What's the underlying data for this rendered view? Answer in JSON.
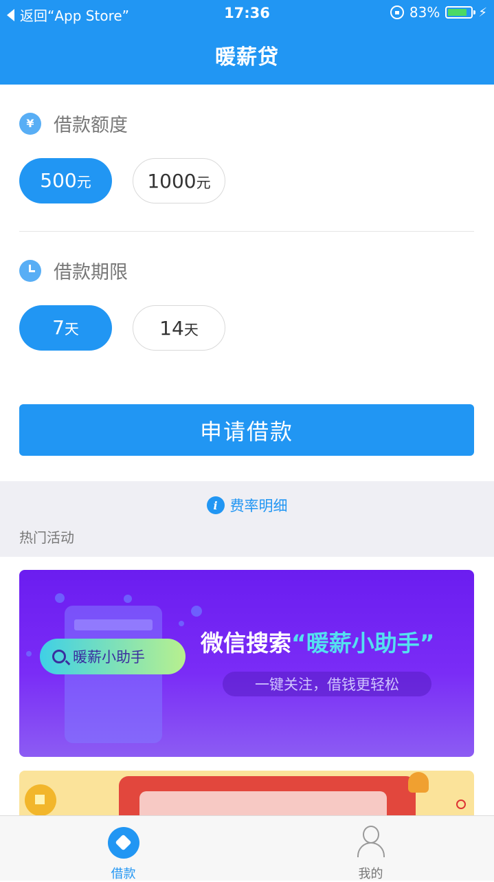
{
  "status_bar": {
    "back_label": "返回“App Store”",
    "time": "17:36",
    "battery": "83%",
    "battery_level": 0.83
  },
  "header": {
    "title": "暖薪贷"
  },
  "amount_section": {
    "label": "借款额度",
    "icon_glyph": "¥",
    "options": [
      {
        "value": "500",
        "unit": "元",
        "selected": true
      },
      {
        "value": "1000",
        "unit": "元",
        "selected": false
      }
    ]
  },
  "term_section": {
    "label": "借款期限",
    "options": [
      {
        "value": "7",
        "unit": "天",
        "selected": true
      },
      {
        "value": "14",
        "unit": "天",
        "selected": false
      }
    ]
  },
  "apply_button": "申请借款",
  "rate_link": {
    "icon_glyph": "i",
    "label": "费率明细"
  },
  "hot_section": {
    "label": "热门活动"
  },
  "banner1": {
    "search_text": "暖薪小助手",
    "title_prefix": "微信搜索",
    "title_highlight": "“暖薪小助手”",
    "subtitle": "一键关注，借钱更轻松"
  },
  "tabbar": {
    "items": [
      {
        "label": "借款",
        "icon": "loan-icon",
        "active": true
      },
      {
        "label": "我的",
        "icon": "person-icon",
        "active": false
      }
    ]
  },
  "colors": {
    "primary": "#2196f3",
    "banner_purple": "#6b1df0",
    "battery_green": "#4cd964"
  }
}
